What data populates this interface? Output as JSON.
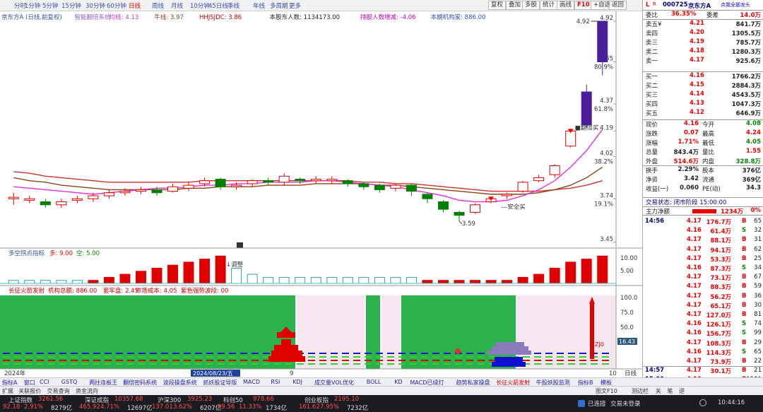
{
  "timeframes": [
    "分时",
    "1分钟",
    "5分钟",
    "15分钟",
    "30分钟",
    "60分钟",
    "日线",
    "周线",
    "月线",
    "10分钟",
    "45日线",
    "季线",
    "年线",
    "多周期",
    "更多"
  ],
  "active_timeframe": "日线",
  "toolbar": [
    "复权",
    "叠加",
    "多股",
    "统计",
    "画线",
    "F10",
    "+自选",
    "返回"
  ],
  "legend": {
    "stock": "京东方A (日线,前复权)",
    "indicator_name": "智能翻倍系统",
    "ma_label": "均线: 4.13",
    "cow_label": "牛线: 3.97",
    "hhjsjdc": "HHJSJDC: 3.86",
    "holders": "本股东人数: 1134173.00",
    "holders_change": "持股人数增减: -4.06",
    "org_holding": "本期机构家: 886.00"
  },
  "price_axis": [
    {
      "price": "4.92",
      "pct": ""
    },
    {
      "price": "4.65",
      "pct": "80.9%"
    },
    {
      "price": "4.37",
      "pct": "61.8%"
    },
    {
      "price": "4.19",
      "pct": ""
    },
    {
      "price": "4.02",
      "pct": "38.2%"
    },
    {
      "price": "3.74",
      "pct": "19.1%"
    },
    {
      "price": "3.45",
      "pct": ""
    }
  ],
  "annotations": {
    "low": "3.59",
    "high": "4.92",
    "buy": "安全买",
    "sell": "翻倍买",
    "adjust": "调整",
    "r_marker": "R"
  },
  "sub1": {
    "title": "多空拐点指标",
    "a": "多: 9.00",
    "b": "空: 5.00",
    "axis": [
      "10.00",
      "5.00"
    ]
  },
  "sub2": {
    "title": "长征火箭发射",
    "org": "机构总额: 886.00",
    "fund": "套牢盘: 2.45",
    "cost": "市场成本: 4.05",
    "tip": "紫色强势波段: 00",
    "axis": [
      "100.0",
      "75.0",
      "50.0",
      "25.0"
    ],
    "cursor_val": "16.43",
    "zj": "ZJ0"
  },
  "x_labels": [
    "2024年",
    "2024/08/23/五",
    "9",
    "10"
  ],
  "xaxis_btns": [
    "日线"
  ],
  "tabs_row": [
    "指标A",
    "窗口",
    "CCI",
    "GSTQ",
    "两拄连板王",
    "翻倍密码系统",
    "波段操盘系统",
    "抓妖股证导版",
    "MACD",
    "RSI",
    "KDJ",
    "成交量VOL优化",
    "BOLL",
    "KD",
    "MACD已绿灯",
    "趋势私家操盘",
    "长征火箭发射",
    "牛股妖股监测"
  ],
  "tabs_row2": [
    "扩展",
    "关联报价",
    "交易查询",
    "资金流向"
  ],
  "right_tabs": [
    "指标B",
    "模板"
  ],
  "right_tabs2": [
    "图文F10",
    "测边栏",
    "关",
    "笔",
    "逆"
  ],
  "quote": {
    "code": "000725",
    "name": "京东方A",
    "note": "点我全部龙头",
    "webi": {
      "l": "委比",
      "v": "36.35%",
      "l2": "委差",
      "v2": "14.0万"
    },
    "asks": [
      {
        "l": "卖五¥",
        "p": "4.21",
        "v": "841.7万"
      },
      {
        "l": "卖四",
        "p": "4.20",
        "v": "1305.5万"
      },
      {
        "l": "卖三",
        "p": "4.19",
        "v": "785.7万"
      },
      {
        "l": "卖二",
        "p": "4.18",
        "v": "1280.3万"
      },
      {
        "l": "卖一",
        "p": "4.17",
        "v": "925.6万"
      }
    ],
    "bids": [
      {
        "l": "买一",
        "p": "4.16",
        "v": "1766.2万"
      },
      {
        "l": "买二",
        "p": "4.15",
        "v": "2884.3万"
      },
      {
        "l": "买三",
        "p": "4.14",
        "v": "4543.5万"
      },
      {
        "l": "买四",
        "p": "4.13",
        "v": "1047.3万"
      },
      {
        "l": "买五",
        "p": "4.12",
        "v": "646.9万"
      }
    ],
    "stats": [
      {
        "l": "现价",
        "v": "4.16",
        "l2": "今开",
        "v2": "4.08"
      },
      {
        "l": "涨跌",
        "v": "0.07",
        "l2": "最高",
        "v2": "4.24"
      },
      {
        "l": "涨幅",
        "v": "1.71%",
        "l2": "最低",
        "v2": "4.05"
      },
      {
        "l": "总量",
        "v": "843.4万",
        "l2": "量比",
        "v2": "1.55"
      },
      {
        "l": "外盘",
        "v": "514.6万",
        "l2": "内盘",
        "v2": "328.8万"
      },
      {
        "l": "换手",
        "v": "2.29%",
        "l2": "股本",
        "v2": "376亿"
      },
      {
        "l": "净资",
        "v": "3.42",
        "l2": "流通",
        "v2": "369亿"
      },
      {
        "l": "收益(一)",
        "v": "0.060",
        "l2": "PE(动)",
        "v2": "34.3"
      }
    ],
    "status": "交易状态: 闭市阶段 15:00:00",
    "netflow": {
      "l": "主力净额",
      "v": "1234万",
      "p": "0%"
    },
    "ticks": [
      {
        "t": "14:56",
        "p": "4.17",
        "v": "176.7万",
        "s": "B",
        "n": "65"
      },
      {
        "t": "",
        "p": "4.16",
        "v": "61.4万",
        "s": "S",
        "n": "32"
      },
      {
        "t": "",
        "p": "4.17",
        "v": "88.1万",
        "s": "B",
        "n": "31"
      },
      {
        "t": "",
        "p": "4.17",
        "v": "94.1万",
        "s": "B",
        "n": "62"
      },
      {
        "t": "",
        "p": "4.17",
        "v": "53.3万",
        "s": "B",
        "n": "25"
      },
      {
        "t": "",
        "p": "4.16",
        "v": "87.3万",
        "s": "S",
        "n": "34"
      },
      {
        "t": "",
        "p": "4.17",
        "v": "73.1万",
        "s": "B",
        "n": "67"
      },
      {
        "t": "",
        "p": "4.17",
        "v": "88.3万",
        "s": "B",
        "n": "59"
      },
      {
        "t": "",
        "p": "4.17",
        "v": "56.2万",
        "s": "B",
        "n": "36"
      },
      {
        "t": "",
        "p": "4.17",
        "v": "65.1万",
        "s": "B",
        "n": "30"
      },
      {
        "t": "",
        "p": "4.17",
        "v": "127.0万",
        "s": "B",
        "n": "81"
      },
      {
        "t": "",
        "p": "4.16",
        "v": "126.1万",
        "s": "S",
        "n": "74"
      },
      {
        "t": "",
        "p": "4.16",
        "v": "156.7万",
        "s": "S",
        "n": "99"
      },
      {
        "t": "",
        "p": "4.17",
        "v": "108.3万",
        "s": "B",
        "n": "29"
      },
      {
        "t": "",
        "p": "4.16",
        "v": "114.3万",
        "s": "S",
        "n": "65"
      },
      {
        "t": "",
        "p": "4.17",
        "v": "73.9万",
        "s": "B",
        "n": "22"
      },
      {
        "t": "14:57",
        "p": "4.17",
        "v": "30.1万",
        "s": "B",
        "n": "21"
      },
      {
        "t": "15:00",
        "p": "4.16",
        "v": "5428.2万",
        "s": "B",
        "n": "1581"
      }
    ]
  },
  "indices": [
    {
      "name": "上证指数",
      "val": "3261.56",
      "chg": "92.18",
      "pct": "2.91%",
      "amt": "8279亿"
    },
    {
      "name": "深证成指",
      "val": "10357.68",
      "chg": "465.92",
      "pct": "4.71%",
      "amt": "12697亿"
    },
    {
      "name": "沪深300",
      "val": "3925.23",
      "chg": "137.01",
      "pct": "3.62%",
      "amt": "6207亿"
    },
    {
      "name": "科创50",
      "val": "978.66",
      "chg": "99.56",
      "pct": "11.33%",
      "amt": "1734亿"
    },
    {
      "name": "创业板指",
      "val": "2195.10",
      "chg": "161.62",
      "pct": "7.95%",
      "amt": "7232亿"
    }
  ],
  "taskbar": {
    "conn": "已连接",
    "trade": "交易未登录",
    "time": "10:44:16"
  },
  "chart_data": {
    "type": "candlestick",
    "ylim": [
      3.45,
      4.92
    ],
    "candles": [
      [
        3.74,
        3.75,
        3.7,
        3.78
      ],
      [
        3.73,
        3.74,
        3.71,
        3.76
      ],
      [
        3.72,
        3.7,
        3.68,
        3.74
      ],
      [
        3.7,
        3.72,
        3.68,
        3.74
      ],
      [
        3.73,
        3.74,
        3.71,
        3.76
      ],
      [
        3.74,
        3.76,
        3.72,
        3.78
      ],
      [
        3.76,
        3.78,
        3.74,
        3.8
      ],
      [
        3.78,
        3.79,
        3.76,
        3.81
      ],
      [
        3.79,
        3.8,
        3.77,
        3.82
      ],
      [
        3.8,
        3.78,
        3.76,
        3.82
      ],
      [
        3.79,
        3.82,
        3.78,
        3.84
      ],
      [
        3.81,
        3.83,
        3.79,
        3.85
      ],
      [
        3.84,
        3.86,
        3.82,
        3.88
      ],
      [
        3.87,
        3.82,
        3.8,
        3.88
      ],
      [
        3.82,
        3.83,
        3.8,
        3.85
      ],
      [
        3.84,
        3.86,
        3.82,
        3.87
      ],
      [
        3.86,
        3.85,
        3.83,
        3.88
      ],
      [
        3.85,
        3.89,
        3.83,
        3.91
      ],
      [
        3.87,
        3.86,
        3.84,
        3.88
      ],
      [
        3.86,
        3.87,
        3.84,
        3.89
      ],
      [
        3.86,
        3.87,
        3.84,
        3.89
      ],
      [
        3.86,
        3.84,
        3.82,
        3.87
      ],
      [
        3.84,
        3.82,
        3.8,
        3.85
      ],
      [
        3.83,
        3.8,
        3.78,
        3.84
      ],
      [
        3.81,
        3.83,
        3.79,
        3.84
      ],
      [
        3.83,
        3.79,
        3.76,
        3.84
      ],
      [
        3.77,
        3.74,
        3.71,
        3.78
      ],
      [
        3.72,
        3.67,
        3.65,
        3.73
      ],
      [
        3.65,
        3.63,
        3.59,
        3.66
      ],
      [
        3.65,
        3.7,
        3.64,
        3.71
      ],
      [
        3.72,
        3.74,
        3.71,
        3.75
      ],
      [
        3.76,
        3.77,
        3.74,
        3.78
      ],
      [
        3.79,
        3.85,
        3.78,
        3.86
      ],
      [
        3.86,
        3.88,
        3.85,
        3.9
      ],
      [
        3.9,
        3.96,
        3.88,
        3.97
      ],
      [
        4.09,
        4.19,
        4.08,
        4.2
      ],
      [
        4.23,
        4.45,
        4.21,
        4.5
      ],
      [
        4.65,
        4.92,
        4.56,
        4.92
      ]
    ],
    "ma_pink": [
      3.82,
      3.81,
      3.8,
      3.79,
      3.78,
      3.77,
      3.78,
      3.79,
      3.8,
      3.81,
      3.81,
      3.82,
      3.83,
      3.83,
      3.84,
      3.84,
      3.85,
      3.85,
      3.85,
      3.86,
      3.86,
      3.85,
      3.84,
      3.83,
      3.82,
      3.8,
      3.78,
      3.76,
      3.73,
      3.72,
      3.72,
      3.73,
      3.76,
      3.8,
      3.86,
      3.95,
      4.06,
      4.2
    ],
    "ma_brown": [
      3.88,
      3.86,
      3.85,
      3.83,
      3.82,
      3.81,
      3.8,
      3.8,
      3.8,
      3.8,
      3.8,
      3.81,
      3.81,
      3.82,
      3.82,
      3.82,
      3.83,
      3.83,
      3.83,
      3.84,
      3.84,
      3.84,
      3.84,
      3.83,
      3.83,
      3.82,
      3.81,
      3.8,
      3.79,
      3.78,
      3.77,
      3.77,
      3.77,
      3.78,
      3.8,
      3.83,
      3.88,
      3.95
    ],
    "ma_red": [
      3.92,
      3.91,
      3.89,
      3.88,
      3.87,
      3.86,
      3.85,
      3.85,
      3.85,
      3.85,
      3.85,
      3.85,
      3.86,
      3.86,
      3.86,
      3.86,
      3.86,
      3.86,
      3.86,
      3.86,
      3.86,
      3.86,
      3.85,
      3.85,
      3.84,
      3.84,
      3.83,
      3.82,
      3.81,
      3.8,
      3.79,
      3.79,
      3.79,
      3.79,
      3.8,
      3.81,
      3.83,
      3.86
    ],
    "sub1_values": [
      1,
      1,
      1,
      1,
      1,
      1,
      2,
      3,
      4,
      5,
      6,
      7,
      8,
      9,
      5,
      3,
      2,
      2,
      2,
      2,
      2,
      2,
      2,
      2,
      2,
      2,
      1,
      1,
      1,
      1,
      1,
      1,
      2,
      3,
      5,
      7,
      8,
      9
    ],
    "sub1_side": [
      "e",
      "e",
      "e",
      "e",
      "e",
      "r",
      "r",
      "r",
      "r",
      "r",
      "r",
      "r",
      "r",
      "r",
      "e",
      "e",
      "e",
      "e",
      "e",
      "e",
      "e",
      "e",
      "e",
      "e",
      "e",
      "e",
      "r",
      "r",
      "r",
      "r",
      "r",
      "r",
      "r",
      "r",
      "r",
      "r",
      "r",
      "r"
    ]
  }
}
